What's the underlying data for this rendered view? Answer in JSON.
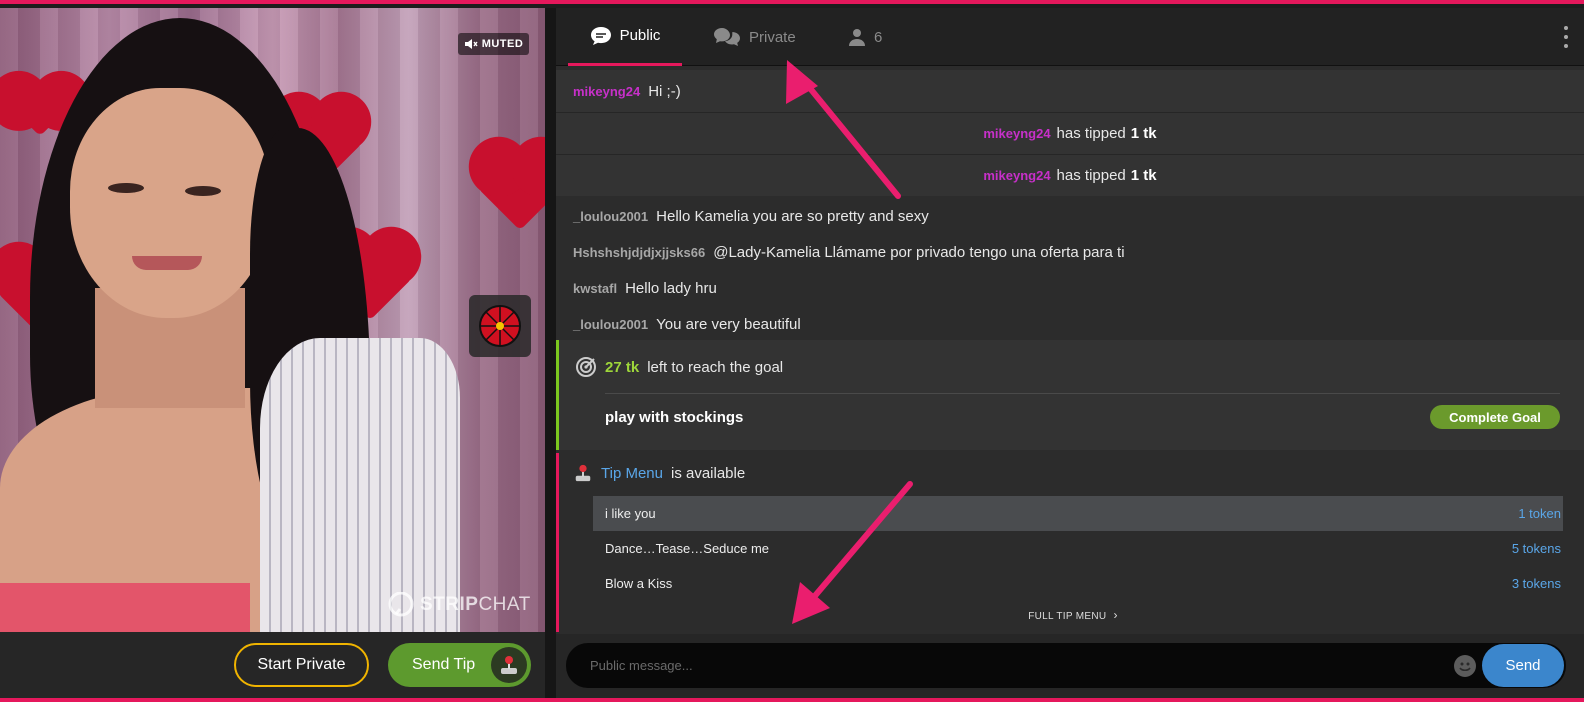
{
  "video": {
    "muted_label": "MUTED",
    "watermark": {
      "strip": "STRIP",
      "chat": "CHAT"
    },
    "start_private_label": "Start Private",
    "send_tip_label": "Send Tip"
  },
  "chat": {
    "tabs": {
      "public": "Public",
      "private": "Private",
      "users_count": "6"
    },
    "messages_top": {
      "user": "mikeyng24",
      "text": "Hi ;-)"
    },
    "tips": [
      {
        "user": "mikeyng24",
        "text": "has tipped",
        "amount": "1 tk"
      },
      {
        "user": "mikeyng24",
        "text": "has tipped",
        "amount": "1 tk"
      }
    ],
    "messages": [
      {
        "user": "_loulou2001",
        "text": "Hello Kamelia you are so pretty and sexy"
      },
      {
        "user": "Hshshshjdjdjxjjsks66",
        "text": "@Lady-Kamelia  Llámame por privado tengo una oferta para ti"
      },
      {
        "user": "kwstafl",
        "text": "Hello lady hru"
      },
      {
        "user": "_loulou2001",
        "text": "You are very beautiful"
      }
    ],
    "goal": {
      "amount": "27 tk",
      "left_text": "left to reach the goal",
      "goal_text": "play with stockings",
      "complete_label": "Complete Goal"
    },
    "tip_menu": {
      "link": "Tip Menu",
      "available_text": "is available",
      "items": [
        {
          "label": "i like you",
          "price": "1 token"
        },
        {
          "label": "Dance…Tease…Seduce me",
          "price": "5 tokens"
        },
        {
          "label": "Blow a Kiss",
          "price": "3 tokens"
        }
      ],
      "full_menu_label": "FULL TIP MENU"
    },
    "composer": {
      "placeholder": "Public message...",
      "send_label": "Send"
    }
  },
  "colors": {
    "accent": "#e5185c",
    "goal_green": "#7cc71f",
    "send_tip_green": "#5d9a2e",
    "start_private_border": "#f0b400",
    "link_blue": "#5aa6e8",
    "username_purple": "#c730c9"
  }
}
